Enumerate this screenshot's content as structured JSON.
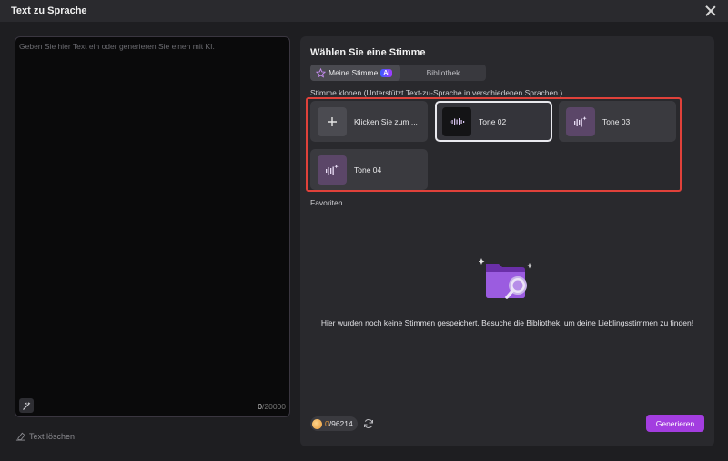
{
  "window": {
    "title": "Text zu Sprache"
  },
  "editor": {
    "placeholder": "Geben Sie hier Text ein oder generieren Sie einen mit KI.",
    "count_current": "0",
    "count_max": "/20000",
    "clear_label": "Text löschen"
  },
  "voice": {
    "heading": "Wählen Sie eine Stimme",
    "tabs": [
      {
        "label": "Meine Stimme",
        "badge": "AI",
        "active": true
      },
      {
        "label": "Bibliothek",
        "active": false
      }
    ],
    "clone_label": "Stimme klonen (Unterstützt Text-zu-Sprache in verschiedenen Sprachen.)",
    "cards": [
      {
        "label": "Klicken Sie zum ...",
        "icon": "plus-icon"
      },
      {
        "label": "Tone 02",
        "icon": "waveform-icon",
        "selected": true
      },
      {
        "label": "Tone 03",
        "icon": "voice-sparkle-icon"
      },
      {
        "label": "Tone 04",
        "icon": "voice-sparkle-icon"
      }
    ],
    "favorites_label": "Favoriten",
    "empty_message": "Hier wurden noch keine Stimmen gespeichert. Besuche die Bibliothek, um deine Lieblingsstimmen zu finden!"
  },
  "footer": {
    "credits_used": "0",
    "credits_total": "/96214",
    "generate_label": "Generieren"
  },
  "colors": {
    "accent": "#a33de0",
    "highlight_border": "#e0413a",
    "coin": "#e89a3c"
  }
}
